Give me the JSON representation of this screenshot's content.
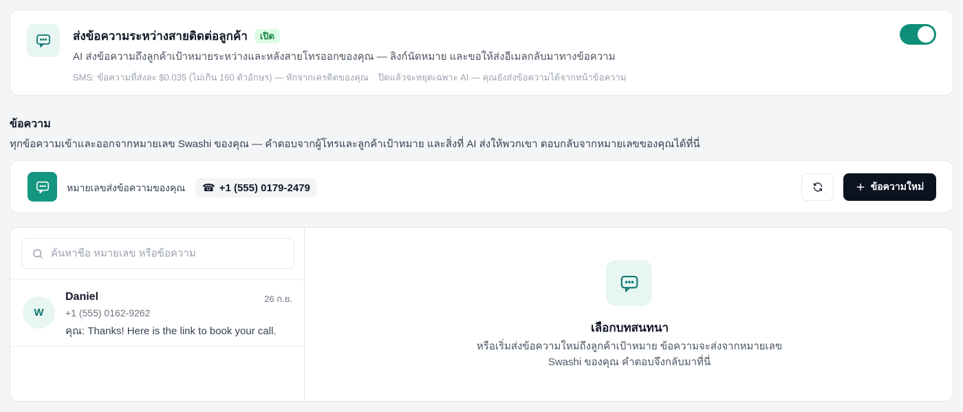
{
  "feature": {
    "icon": "chat-bubble-icon",
    "title": "ส่งข้อความระหว่างสายติดต่อลูกค้า",
    "status_badge": "เปิด",
    "description": "AI ส่งข้อความถึงลูกค้าเป้าหมายระหว่างและหลังสายโทรออกของคุณ — ลิงก์นัดหมาย และขอให้ส่งอีเมลกลับมาทางข้อความ",
    "note_cost": "SMS: ข้อความที่ส่งละ $0.035 (ไม่เกิน 160 ตัวอักษร) — หักจากเครดิตของคุณ",
    "note_off": "ปิดแล้วจะหยุดเฉพาะ AI — คุณยังส่งข้อความได้จากหน้าข้อความ",
    "enabled": true
  },
  "messages_section": {
    "title": "ข้อความ",
    "description": "ทุกข้อความเข้าและออกจากหมายเลข Swashi ของคุณ — คำตอบจากผู้โทรและลูกค้าเป้าหมาย และสิ่งที่ AI ส่งให้พวกเขา ตอบกลับจากหมายเลขของคุณได้ที่นี่"
  },
  "number_bar": {
    "label": "หมายเลขส่งข้อความของคุณ",
    "phone_icon": "☎",
    "phone_number": "+1 (555) 0179-2479",
    "new_message_label": "ข้อความใหม่"
  },
  "search": {
    "placeholder": "ค้นหาชื่อ หมายเลข หรือข้อความ"
  },
  "conversations": [
    {
      "avatar_initial": "W",
      "name": "Daniel",
      "date": "26 ก.ย.",
      "phone": "+1 (555) 0162-9262",
      "preview": "คุณ: Thanks! Here is the link to book your call."
    }
  ],
  "empty_state": {
    "title": "เลือกบทสนทนา",
    "description": "หรือเริ่มส่งข้อความใหม่ถึงลูกค้าเป้าหมาย ข้อความจะส่งจากหมายเลข Swashi ของคุณ คำตอบจึงกลับมาที่นี่"
  },
  "colors": {
    "accent": "#14967f",
    "toggle_on": "#0f8f7a",
    "primary_button": "#0b1220",
    "badge_bg": "#dcfce7",
    "badge_text": "#15803d"
  }
}
